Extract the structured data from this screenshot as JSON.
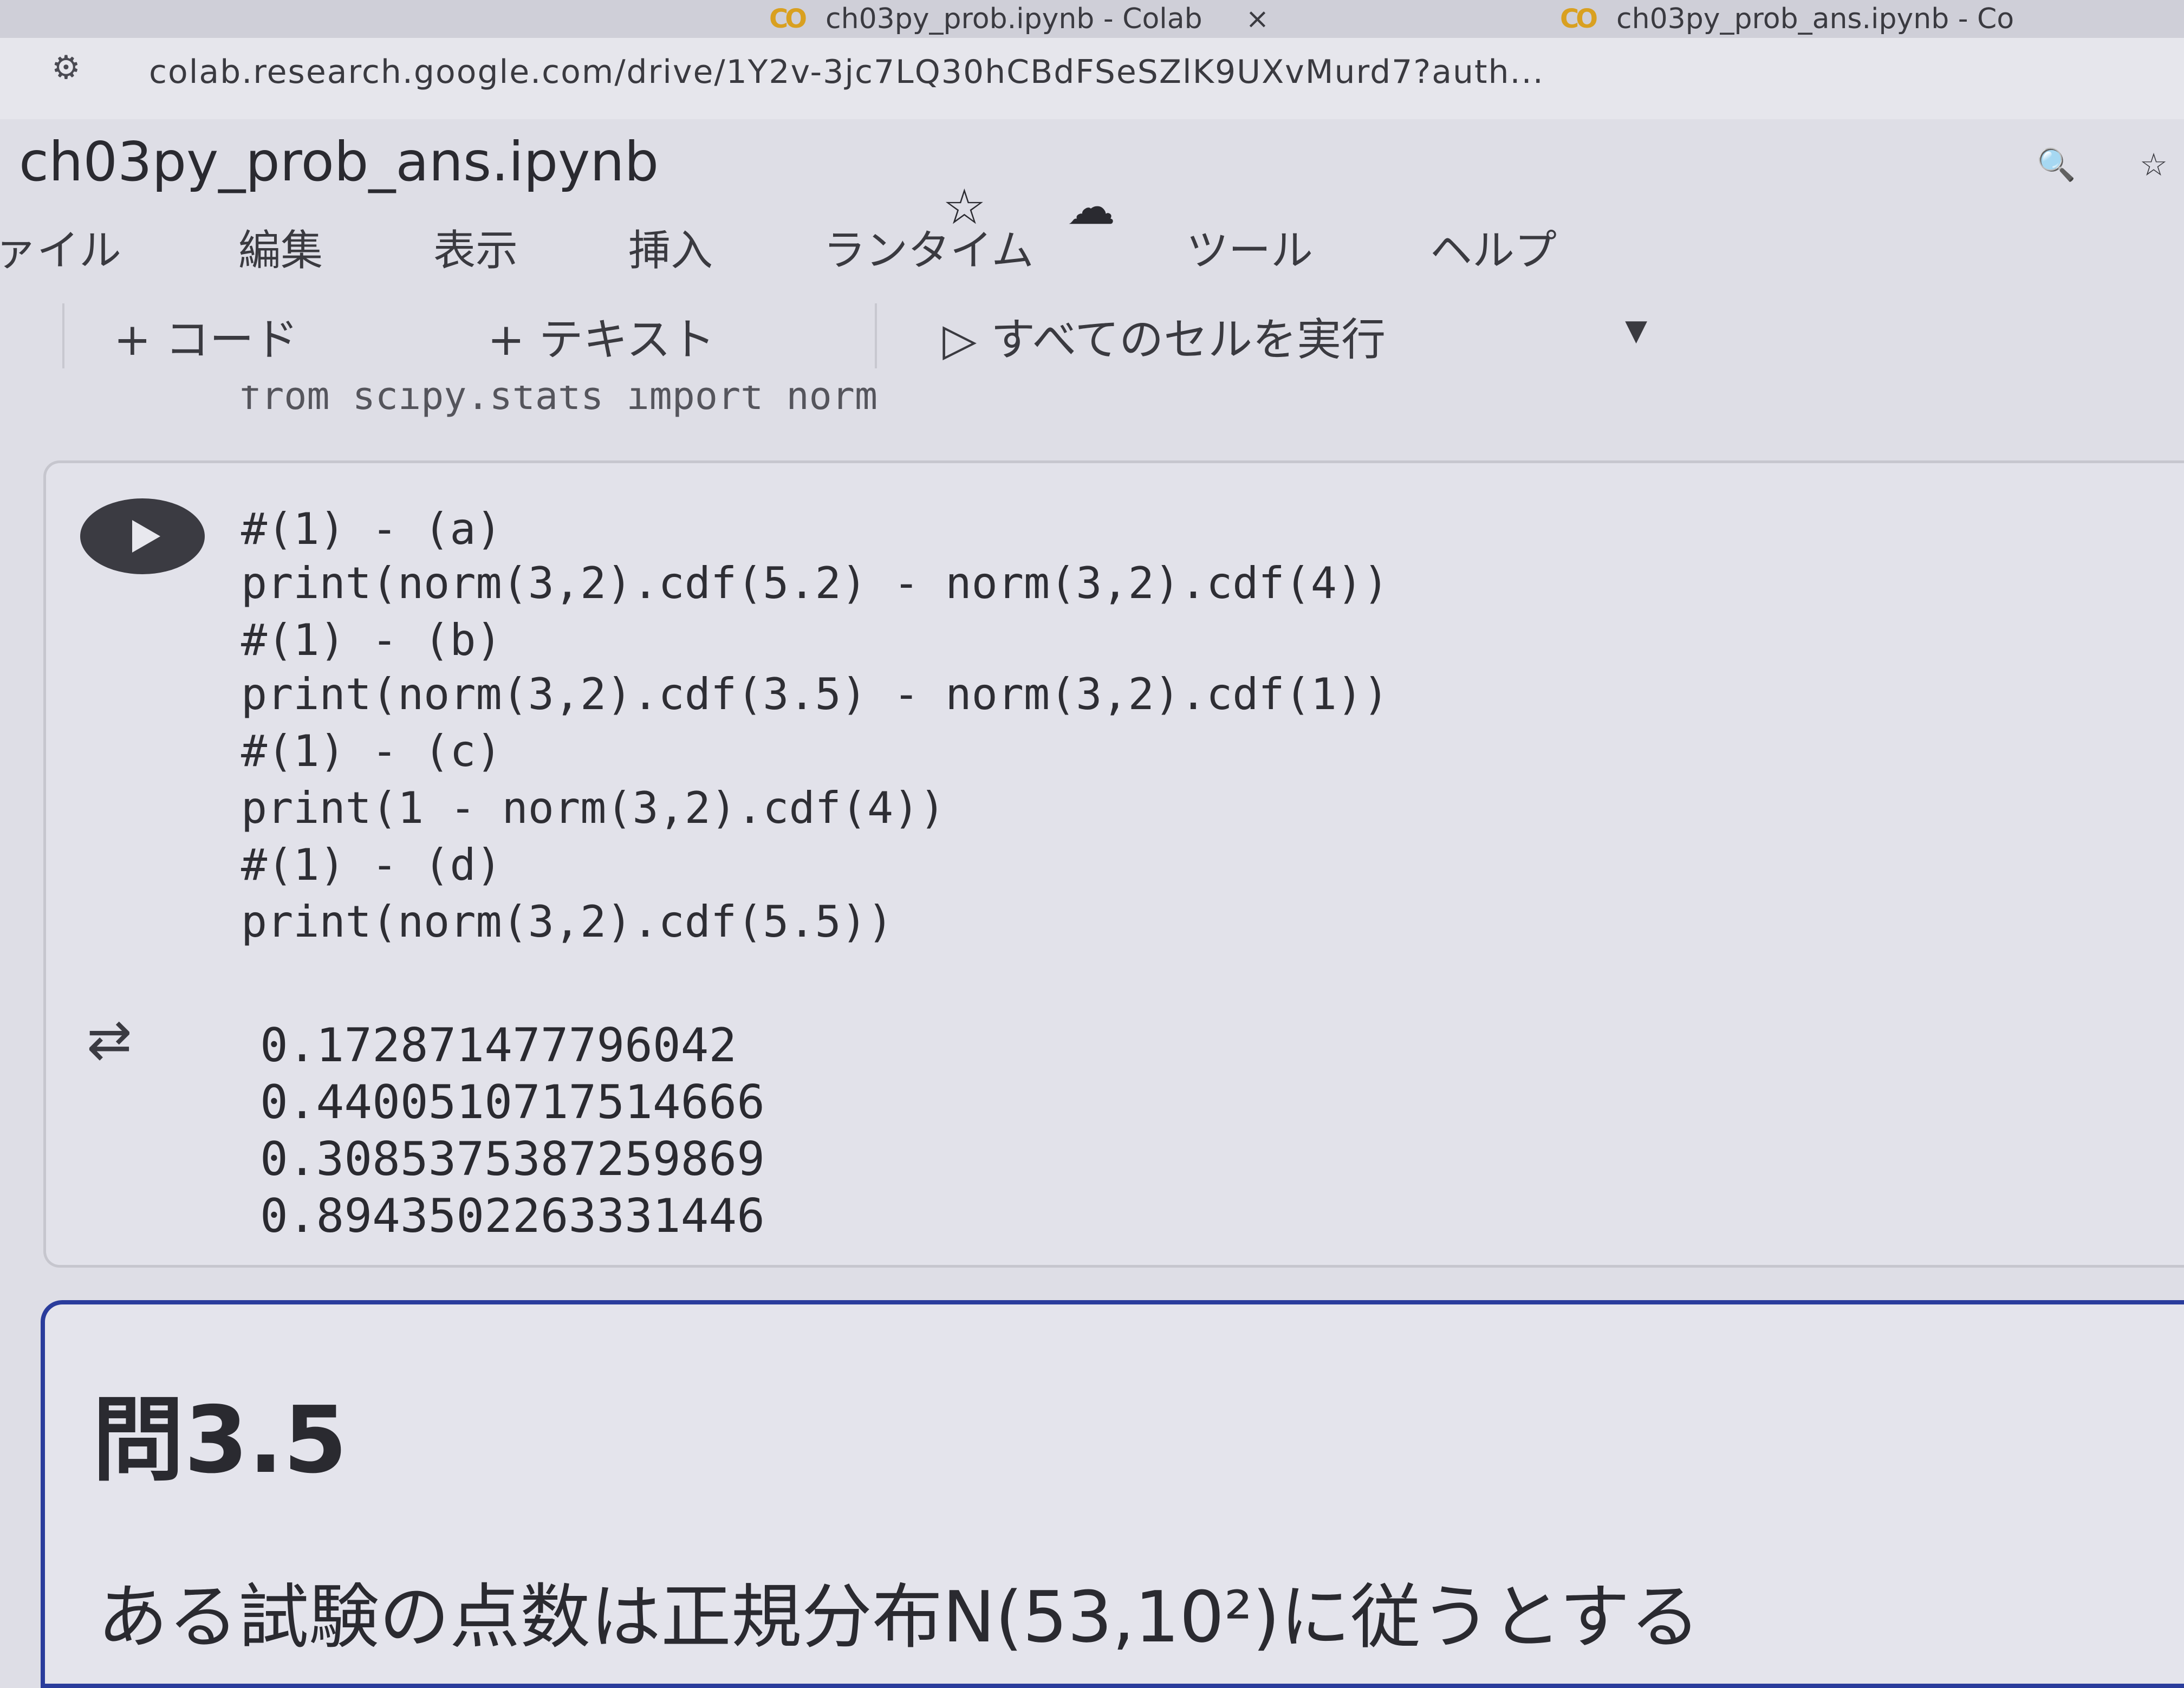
{
  "browser": {
    "tabs": [
      {
        "icon": "CO",
        "title": "ch03py_prob.ipynb - Colab",
        "close": "×"
      },
      {
        "icon": "CO",
        "title": "ch03py_prob_ans.ipynb - Co"
      }
    ],
    "url": "colab.research.google.com/drive/1Y2v-3jc7LQ30hCBdFSeSZlK9UXvMurd7?auth..."
  },
  "notebook": {
    "title": "ch03py_prob_ans.ipynb"
  },
  "menu": [
    "ァイル",
    "編集",
    "表示",
    "挿入",
    "ランタイム",
    "ツール",
    "ヘルプ"
  ],
  "toolbar": {
    "add_code": "+ コード",
    "add_text": "+ テキスト",
    "run_all": "▷ すべてのセルを実行",
    "dropdown": "▾"
  },
  "cut_line": "from scipy.stats import norm",
  "code_cell": {
    "lines": [
      "#(1) - (a)",
      "print(norm(3,2).cdf(5.2) - norm(3,2).cdf(4))",
      "#(1) - (b)",
      "print(norm(3,2).cdf(3.5) - norm(3,2).cdf(1))",
      "#(1) - (c)",
      "print(1 - norm(3,2).cdf(4))",
      "#(1) - (d)",
      "print(norm(3,2).cdf(5.5))"
    ],
    "output": [
      "0.172871477796042",
      "0.4400510717514666",
      "0.3085375387259869",
      "0.8943502263331446"
    ]
  },
  "text_cell": {
    "heading": "問3.5",
    "paragraph": "ある試験の点数は正規分布N(53,10²)に従うとする"
  }
}
